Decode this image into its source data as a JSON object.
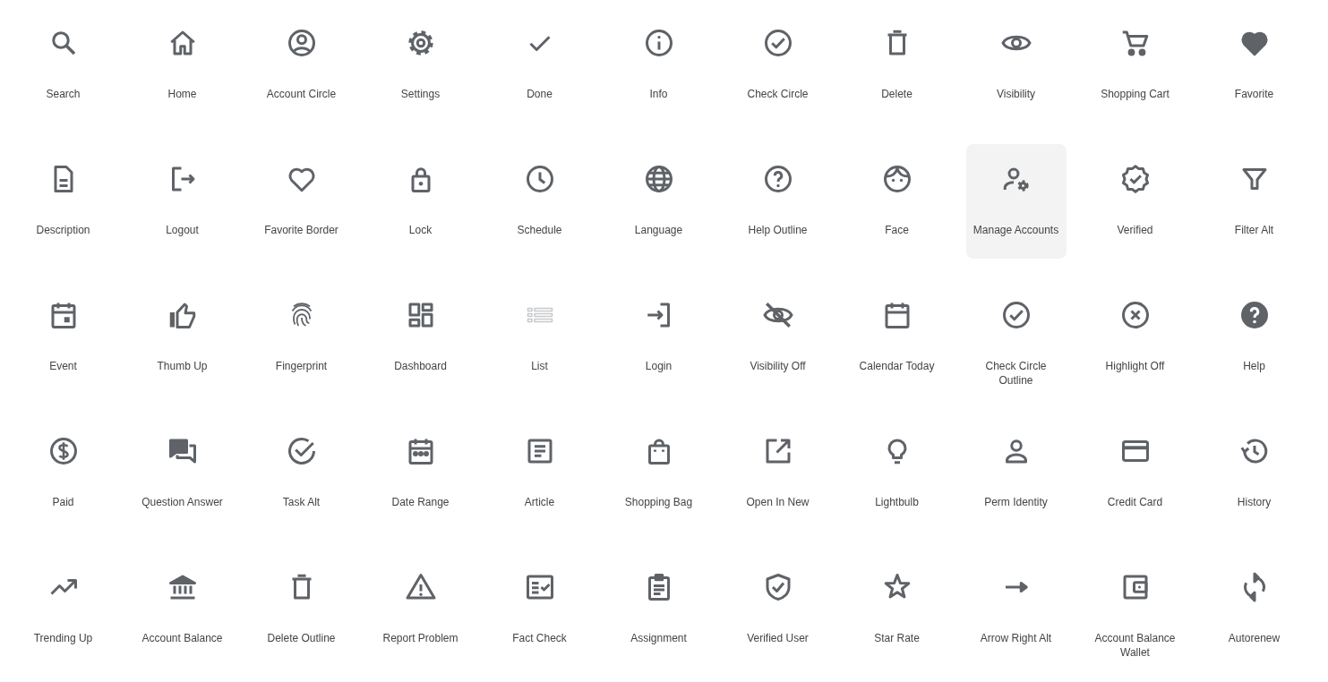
{
  "icons": [
    {
      "label": "Search",
      "selected": false,
      "dimmed": false
    },
    {
      "label": "Home",
      "selected": false,
      "dimmed": false
    },
    {
      "label": "Account Circle",
      "selected": false,
      "dimmed": false
    },
    {
      "label": "Settings",
      "selected": false,
      "dimmed": false
    },
    {
      "label": "Done",
      "selected": false,
      "dimmed": false
    },
    {
      "label": "Info",
      "selected": false,
      "dimmed": false
    },
    {
      "label": "Check Circle",
      "selected": false,
      "dimmed": false
    },
    {
      "label": "Delete",
      "selected": false,
      "dimmed": false
    },
    {
      "label": "Visibility",
      "selected": false,
      "dimmed": false
    },
    {
      "label": "Shopping Cart",
      "selected": false,
      "dimmed": false
    },
    {
      "label": "Favorite",
      "selected": false,
      "dimmed": false
    },
    {
      "label": "Description",
      "selected": false,
      "dimmed": false
    },
    {
      "label": "Logout",
      "selected": false,
      "dimmed": false
    },
    {
      "label": "Favorite Border",
      "selected": false,
      "dimmed": false
    },
    {
      "label": "Lock",
      "selected": false,
      "dimmed": false
    },
    {
      "label": "Schedule",
      "selected": false,
      "dimmed": false
    },
    {
      "label": "Language",
      "selected": false,
      "dimmed": false
    },
    {
      "label": "Help Outline",
      "selected": false,
      "dimmed": false
    },
    {
      "label": "Face",
      "selected": false,
      "dimmed": false
    },
    {
      "label": "Manage Accounts",
      "selected": true,
      "dimmed": false
    },
    {
      "label": "Verified",
      "selected": false,
      "dimmed": false
    },
    {
      "label": "Filter Alt",
      "selected": false,
      "dimmed": false
    },
    {
      "label": "Event",
      "selected": false,
      "dimmed": false
    },
    {
      "label": "Thumb Up",
      "selected": false,
      "dimmed": false
    },
    {
      "label": "Fingerprint",
      "selected": false,
      "dimmed": false
    },
    {
      "label": "Dashboard",
      "selected": false,
      "dimmed": false
    },
    {
      "label": "List",
      "selected": false,
      "dimmed": true
    },
    {
      "label": "Login",
      "selected": false,
      "dimmed": false
    },
    {
      "label": "Visibility Off",
      "selected": false,
      "dimmed": false
    },
    {
      "label": "Calendar Today",
      "selected": false,
      "dimmed": false
    },
    {
      "label": "Check Circle Outline",
      "selected": false,
      "dimmed": false
    },
    {
      "label": "Highlight Off",
      "selected": false,
      "dimmed": false
    },
    {
      "label": "Help",
      "selected": false,
      "dimmed": false
    },
    {
      "label": "Paid",
      "selected": false,
      "dimmed": false
    },
    {
      "label": "Question Answer",
      "selected": false,
      "dimmed": false
    },
    {
      "label": "Task Alt",
      "selected": false,
      "dimmed": false
    },
    {
      "label": "Date Range",
      "selected": false,
      "dimmed": false
    },
    {
      "label": "Article",
      "selected": false,
      "dimmed": false
    },
    {
      "label": "Shopping Bag",
      "selected": false,
      "dimmed": false
    },
    {
      "label": "Open In New",
      "selected": false,
      "dimmed": false
    },
    {
      "label": "Lightbulb",
      "selected": false,
      "dimmed": false
    },
    {
      "label": "Perm Identity",
      "selected": false,
      "dimmed": false
    },
    {
      "label": "Credit Card",
      "selected": false,
      "dimmed": false
    },
    {
      "label": "History",
      "selected": false,
      "dimmed": false
    },
    {
      "label": "Trending Up",
      "selected": false,
      "dimmed": false
    },
    {
      "label": "Account Balance",
      "selected": false,
      "dimmed": false
    },
    {
      "label": "Delete Outline",
      "selected": false,
      "dimmed": false
    },
    {
      "label": "Report Problem",
      "selected": false,
      "dimmed": false
    },
    {
      "label": "Fact Check",
      "selected": false,
      "dimmed": false
    },
    {
      "label": "Assignment",
      "selected": false,
      "dimmed": false
    },
    {
      "label": "Verified User",
      "selected": false,
      "dimmed": false
    },
    {
      "label": "Star Rate",
      "selected": false,
      "dimmed": false
    },
    {
      "label": "Arrow Right Alt",
      "selected": false,
      "dimmed": false
    },
    {
      "label": "Account Balance Wallet",
      "selected": false,
      "dimmed": false
    },
    {
      "label": "Autorenew",
      "selected": false,
      "dimmed": false
    }
  ]
}
